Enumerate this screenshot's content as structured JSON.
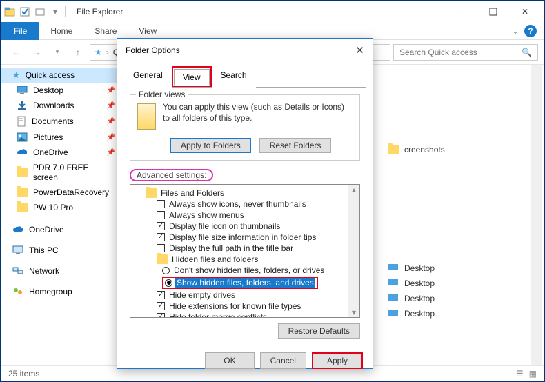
{
  "window": {
    "title": "File Explorer"
  },
  "ribbon": {
    "file": "File",
    "tabs": [
      "Home",
      "Share",
      "View"
    ]
  },
  "search": {
    "placeholder": "Search Quick access"
  },
  "sidebar": {
    "quick_access": "Quick access",
    "items": [
      "Desktop",
      "Downloads",
      "Documents",
      "Pictures",
      "OneDrive",
      "PDR 7.0 FREE screen",
      "PowerDataRecovery",
      "PW 10 Pro"
    ],
    "roots": [
      "OneDrive",
      "This PC",
      "Network",
      "Homegroup"
    ]
  },
  "content": {
    "items": [
      "creenshots",
      "Desktop",
      "Desktop",
      "Desktop",
      "Desktop"
    ]
  },
  "status": {
    "count": "25 items"
  },
  "dialog": {
    "title": "Folder Options",
    "tabs": {
      "general": "General",
      "view": "View",
      "search": "Search"
    },
    "folder_views": {
      "label": "Folder views",
      "text": "You can apply this view (such as Details or Icons) to all folders of this type.",
      "apply": "Apply to Folders",
      "reset": "Reset Folders"
    },
    "advanced": {
      "label": "Advanced settings:",
      "root": "Files and Folders",
      "opts": [
        {
          "type": "cb",
          "checked": false,
          "label": "Always show icons, never thumbnails"
        },
        {
          "type": "cb",
          "checked": false,
          "label": "Always show menus"
        },
        {
          "type": "cb",
          "checked": true,
          "label": "Display file icon on thumbnails"
        },
        {
          "type": "cb",
          "checked": true,
          "label": "Display file size information in folder tips"
        },
        {
          "type": "cb",
          "checked": false,
          "label": "Display the full path in the title bar"
        },
        {
          "type": "folder",
          "label": "Hidden files and folders"
        },
        {
          "type": "rb",
          "checked": false,
          "label": "Don't show hidden files, folders, or drives"
        },
        {
          "type": "rb",
          "checked": true,
          "label": "Show hidden files, folders, and drives",
          "selected": true
        },
        {
          "type": "cb",
          "checked": true,
          "label": "Hide empty drives"
        },
        {
          "type": "cb",
          "checked": true,
          "label": "Hide extensions for known file types"
        },
        {
          "type": "cb",
          "checked": true,
          "label": "Hide folder merge conflicts"
        }
      ],
      "restore": "Restore Defaults"
    },
    "actions": {
      "ok": "OK",
      "cancel": "Cancel",
      "apply": "Apply"
    }
  }
}
